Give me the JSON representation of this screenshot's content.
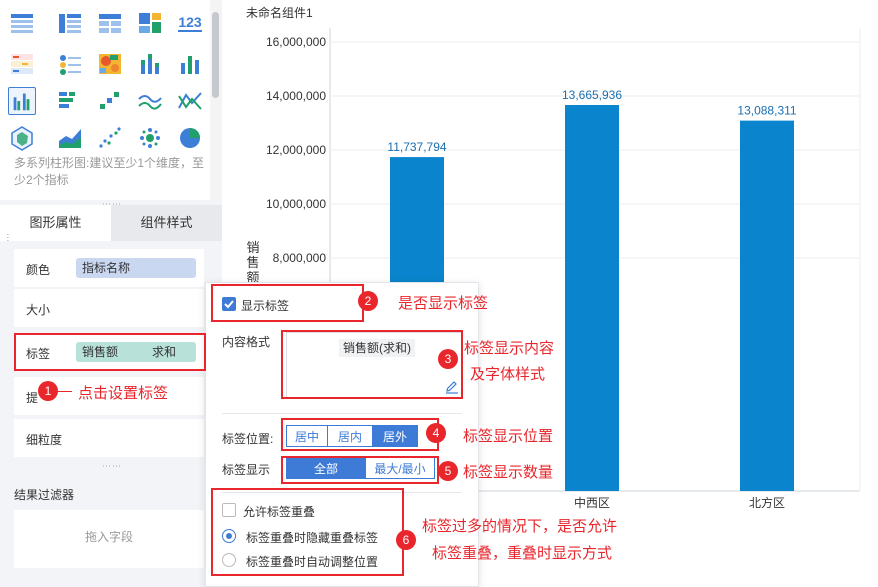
{
  "chart_types": [
    {
      "icon": "table-icon"
    },
    {
      "icon": "cross-table-icon"
    },
    {
      "icon": "detail-table-icon"
    },
    {
      "icon": "tree-map-icon"
    },
    {
      "icon": "kpi-number-icon",
      "text": "123"
    },
    {
      "icon": "number-grid-icon"
    },
    {
      "icon": "dashboard-list-icon"
    },
    {
      "icon": "heat-map-icon"
    },
    {
      "icon": "stacked-bar-icon"
    },
    {
      "icon": "bar-chart-icon"
    },
    {
      "icon": "multi-series-bar-icon",
      "selected": true
    },
    {
      "icon": "horizontal-bar-icon"
    },
    {
      "icon": "scatter-bar-icon"
    },
    {
      "icon": "line-chart-icon"
    },
    {
      "icon": "combo-line-icon"
    },
    {
      "icon": "radar-chart-icon"
    },
    {
      "icon": "area-chart-icon"
    },
    {
      "icon": "scatter-plot-icon"
    },
    {
      "icon": "bubble-chart-icon"
    },
    {
      "icon": "pie-chart-icon"
    }
  ],
  "chart_description": "多系列柱形图:建议至少1个维度，至少2个指标",
  "tabs": {
    "shape": "图形属性",
    "style": "组件样式"
  },
  "props": {
    "color_label": "颜色",
    "color_field": "指标名称",
    "size_label": "大小",
    "label_label": "标签",
    "label_field": "销售额",
    "label_agg": "求和",
    "tooltip_label": "提",
    "granularity_label": "细粒度"
  },
  "filter": {
    "title": "结果过滤器",
    "drop_hint": "拖入字段"
  },
  "chart_data": {
    "type": "bar",
    "title": "未命名组件1",
    "ylabel": "销售额",
    "categories": [
      "",
      "中西区",
      "北方区"
    ],
    "values": [
      11737794,
      13665936,
      13088311
    ],
    "value_labels": [
      "11,737,794",
      "13,665,936",
      "13,088,311"
    ],
    "yticks": [
      "8,000,000",
      "10,000,000",
      "12,000,000",
      "14,000,000",
      "16,000,000"
    ],
    "ylim": [
      0,
      16000000
    ],
    "bar_color": "#0a84cc",
    "label_color": "#1a6fb0"
  },
  "popup": {
    "show_label": "显示标签",
    "content_format_label": "内容格式",
    "content_format_value": "销售额(求和)",
    "position_label": "标签位置:",
    "positions": [
      "居中",
      "居内",
      "居外"
    ],
    "display_label": "标签显示",
    "displays": [
      "全部",
      "最大/最小"
    ],
    "allow_overlap": "允许标签重叠",
    "overlap_hide": "标签重叠时隐藏重叠标签",
    "overlap_adjust": "标签重叠时自动调整位置"
  },
  "annotations": [
    {
      "num": "1",
      "text": "点击设置标签"
    },
    {
      "num": "2",
      "text": "是否显示标签"
    },
    {
      "num": "3",
      "line1": "标签显示内容",
      "line2": "及字体样式"
    },
    {
      "num": "4",
      "text": "标签显示位置"
    },
    {
      "num": "5",
      "text": "标签显示数量"
    },
    {
      "num": "6",
      "line1": "标签过多的情况下，是否允许",
      "line2": "标签重叠，重叠时显示方式"
    }
  ],
  "colors": {
    "accent": "#3e7bd6",
    "annotation": "#e8262c"
  }
}
